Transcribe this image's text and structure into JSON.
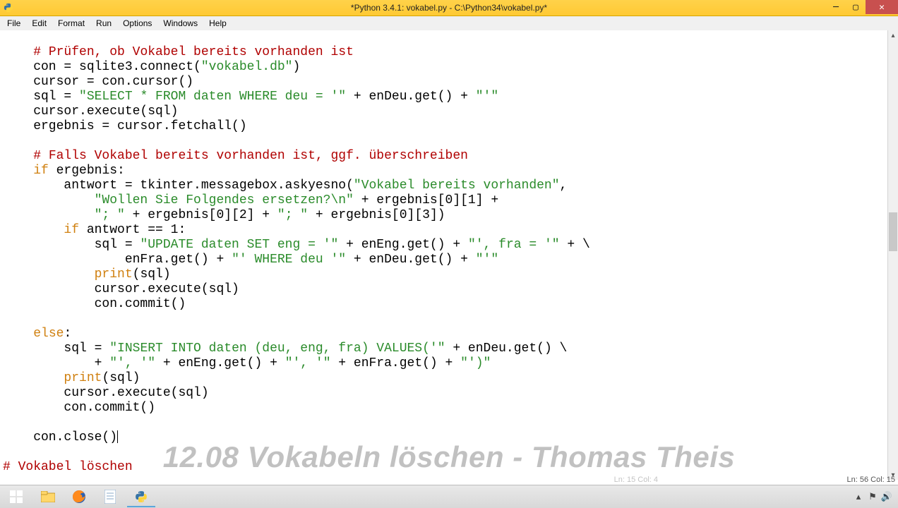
{
  "window": {
    "title": "*Python 3.4.1: vokabel.py - C:\\Python34\\vokabel.py*"
  },
  "menu": {
    "items": [
      "File",
      "Edit",
      "Format",
      "Run",
      "Options",
      "Windows",
      "Help"
    ]
  },
  "code_lines": [
    {
      "indent": 0,
      "tokens": [
        {
          "cls": "",
          "t": ""
        }
      ]
    },
    {
      "indent": 1,
      "tokens": [
        {
          "cls": "cmt",
          "t": "# Prüfen, ob Vokabel bereits vorhanden ist"
        }
      ]
    },
    {
      "indent": 1,
      "tokens": [
        {
          "cls": "",
          "t": "con = sqlite3.connect("
        },
        {
          "cls": "str",
          "t": "\"vokabel.db\""
        },
        {
          "cls": "",
          "t": ")"
        }
      ]
    },
    {
      "indent": 1,
      "tokens": [
        {
          "cls": "",
          "t": "cursor = con.cursor()"
        }
      ]
    },
    {
      "indent": 1,
      "tokens": [
        {
          "cls": "",
          "t": "sql = "
        },
        {
          "cls": "str",
          "t": "\"SELECT * FROM daten WHERE deu = '\""
        },
        {
          "cls": "",
          "t": " + enDeu.get() + "
        },
        {
          "cls": "str",
          "t": "\"'\""
        }
      ]
    },
    {
      "indent": 1,
      "tokens": [
        {
          "cls": "",
          "t": "cursor.execute(sql)"
        }
      ]
    },
    {
      "indent": 1,
      "tokens": [
        {
          "cls": "",
          "t": "ergebnis = cursor.fetchall()"
        }
      ]
    },
    {
      "indent": 0,
      "tokens": [
        {
          "cls": "",
          "t": ""
        }
      ]
    },
    {
      "indent": 1,
      "tokens": [
        {
          "cls": "cmt",
          "t": "# Falls Vokabel bereits vorhanden ist, ggf. überschreiben"
        }
      ]
    },
    {
      "indent": 1,
      "tokens": [
        {
          "cls": "kw",
          "t": "if"
        },
        {
          "cls": "",
          "t": " ergebnis:"
        }
      ]
    },
    {
      "indent": 2,
      "tokens": [
        {
          "cls": "",
          "t": "antwort = tkinter.messagebox.askyesno("
        },
        {
          "cls": "str",
          "t": "\"Vokabel bereits vorhanden\""
        },
        {
          "cls": "",
          "t": ","
        }
      ]
    },
    {
      "indent": 3,
      "tokens": [
        {
          "cls": "str",
          "t": "\"Wollen Sie Folgendes ersetzen?\\n\""
        },
        {
          "cls": "",
          "t": " + ergebnis[0][1] +"
        }
      ]
    },
    {
      "indent": 3,
      "tokens": [
        {
          "cls": "str",
          "t": "\"; \""
        },
        {
          "cls": "",
          "t": " + ergebnis[0][2] + "
        },
        {
          "cls": "str",
          "t": "\"; \""
        },
        {
          "cls": "",
          "t": " + ergebnis[0][3])"
        }
      ]
    },
    {
      "indent": 2,
      "tokens": [
        {
          "cls": "kw",
          "t": "if"
        },
        {
          "cls": "",
          "t": " antwort == 1:"
        }
      ]
    },
    {
      "indent": 3,
      "tokens": [
        {
          "cls": "",
          "t": "sql = "
        },
        {
          "cls": "str",
          "t": "\"UPDATE daten SET eng = '\""
        },
        {
          "cls": "",
          "t": " + enEng.get() + "
        },
        {
          "cls": "str",
          "t": "\"', fra = '\""
        },
        {
          "cls": "",
          "t": " + \\"
        }
      ]
    },
    {
      "indent": 4,
      "tokens": [
        {
          "cls": "",
          "t": "enFra.get() + "
        },
        {
          "cls": "str",
          "t": "\"' WHERE deu '\""
        },
        {
          "cls": "",
          "t": " + enDeu.get() + "
        },
        {
          "cls": "str",
          "t": "\"'\""
        }
      ]
    },
    {
      "indent": 3,
      "tokens": [
        {
          "cls": "kw",
          "t": "print"
        },
        {
          "cls": "",
          "t": "(sql)"
        }
      ]
    },
    {
      "indent": 3,
      "tokens": [
        {
          "cls": "",
          "t": "cursor.execute(sql)"
        }
      ]
    },
    {
      "indent": 3,
      "tokens": [
        {
          "cls": "",
          "t": "con.commit()"
        }
      ]
    },
    {
      "indent": 0,
      "tokens": [
        {
          "cls": "",
          "t": ""
        }
      ]
    },
    {
      "indent": 1,
      "tokens": [
        {
          "cls": "kw",
          "t": "else"
        },
        {
          "cls": "",
          "t": ":"
        }
      ]
    },
    {
      "indent": 2,
      "tokens": [
        {
          "cls": "",
          "t": "sql = "
        },
        {
          "cls": "str",
          "t": "\"INSERT INTO daten (deu, eng, fra) VALUES('\""
        },
        {
          "cls": "",
          "t": " + enDeu.get() \\"
        }
      ]
    },
    {
      "indent": 3,
      "tokens": [
        {
          "cls": "",
          "t": "+ "
        },
        {
          "cls": "str",
          "t": "\"', '\""
        },
        {
          "cls": "",
          "t": " + enEng.get() + "
        },
        {
          "cls": "str",
          "t": "\"', '\""
        },
        {
          "cls": "",
          "t": " + enFra.get() + "
        },
        {
          "cls": "str",
          "t": "\"')\""
        }
      ]
    },
    {
      "indent": 2,
      "tokens": [
        {
          "cls": "kw",
          "t": "print"
        },
        {
          "cls": "",
          "t": "(sql)"
        }
      ]
    },
    {
      "indent": 2,
      "tokens": [
        {
          "cls": "",
          "t": "cursor.execute(sql)"
        }
      ]
    },
    {
      "indent": 2,
      "tokens": [
        {
          "cls": "",
          "t": "con.commit()"
        }
      ]
    },
    {
      "indent": 0,
      "tokens": [
        {
          "cls": "",
          "t": ""
        }
      ]
    },
    {
      "indent": 1,
      "tokens": [
        {
          "cls": "",
          "t": "con.close()"
        }
      ],
      "caret": true
    },
    {
      "indent": 0,
      "tokens": [
        {
          "cls": "",
          "t": ""
        }
      ]
    },
    {
      "indent": 0,
      "tokens": [
        {
          "cls": "cmt",
          "t": "# Vokabel löschen"
        }
      ]
    }
  ],
  "status": {
    "ln_col": "Ln: 56 Col: 15",
    "ln_col_faint": "Ln: 15 Col: 4"
  },
  "watermark": "12.08 Vokabeln löschen - Thomas Theis",
  "taskbar_icons": [
    "start",
    "explorer",
    "firefox",
    "notepad",
    "python-idle"
  ],
  "tray_icons": [
    "chevron-up",
    "flag",
    "speaker"
  ]
}
